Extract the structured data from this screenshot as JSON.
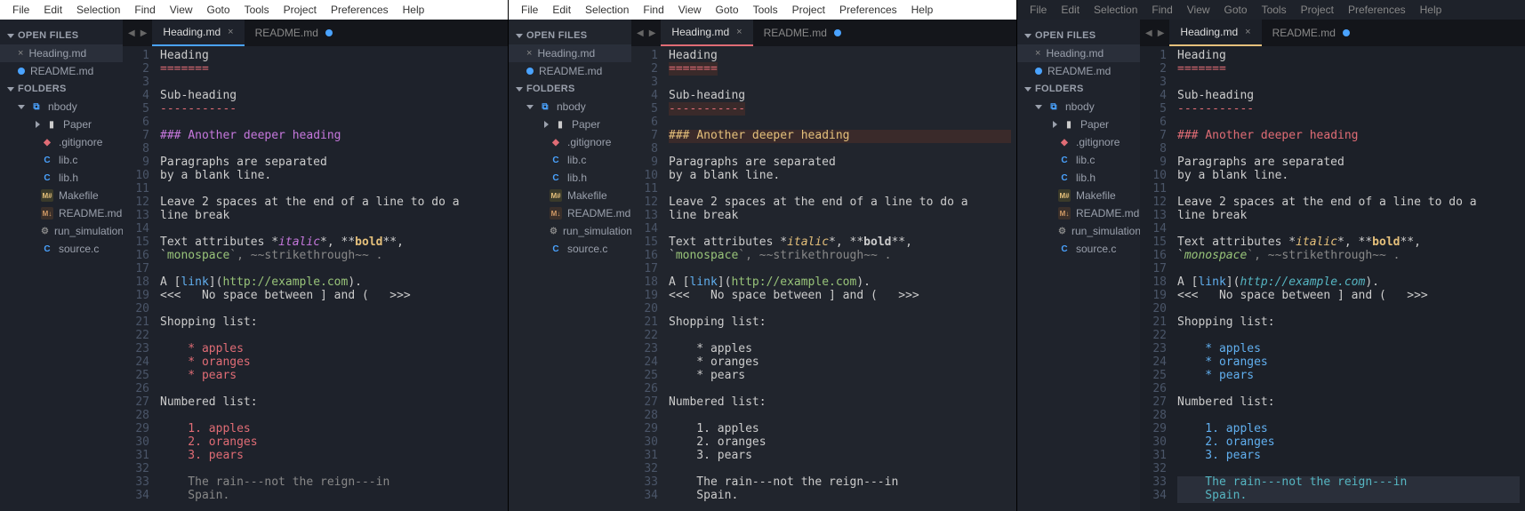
{
  "menu": [
    "File",
    "Edit",
    "Selection",
    "Find",
    "View",
    "Goto",
    "Tools",
    "Project",
    "Preferences",
    "Help"
  ],
  "sidebar": {
    "open_files": "OPEN FILES",
    "folders": "FOLDERS",
    "active_file": "Heading.md",
    "dirty_file": "README.md",
    "root": "nbody",
    "sub": "Paper",
    "files": [
      ".gitignore",
      "lib.c",
      "lib.h",
      "Makefile",
      "README.md",
      "run_simulation",
      "source.c"
    ]
  },
  "tabs": {
    "active": "Heading.md",
    "inactive": "README.md"
  },
  "code": {
    "l1": "Heading",
    "l2": "=======",
    "l3": "",
    "l4": "Sub-heading",
    "l5": "-----------",
    "l6": "",
    "l7_hash": "### ",
    "l7_text": "Another deeper heading",
    "l8": "",
    "l9": "Paragraphs are separated",
    "l10": "by a blank line.",
    "l11": "",
    "l12": "Leave 2 spaces at the end of a line to do a",
    "l13": "line break",
    "l14": "",
    "l15_a": "Text attributes *",
    "l15_b": "italic",
    "l15_c": "*, **",
    "l15_d": "bold",
    "l15_e": "**,",
    "l16_a": "`",
    "l16_b": "monospace",
    "l16_c": "`, ~~strikethrough~~ .",
    "l17": "",
    "l18_a": "A [",
    "l18_b": "link",
    "l18_c": "](",
    "l18_d": "http://example.com",
    "l18_e": ").",
    "l19": "<<<   No space between ] and (   >>>",
    "l20": "",
    "l21": "Shopping list:",
    "l22": "",
    "l23": "    * apples",
    "l24": "    * oranges",
    "l25": "    * pears",
    "l26": "",
    "l27": "Numbered list:",
    "l28": "",
    "l29": "    1. apples",
    "l30": "    2. oranges",
    "l31": "    3. pears",
    "l32": "",
    "l33": "    The rain---not the reign---in",
    "l34": "    Spain."
  }
}
